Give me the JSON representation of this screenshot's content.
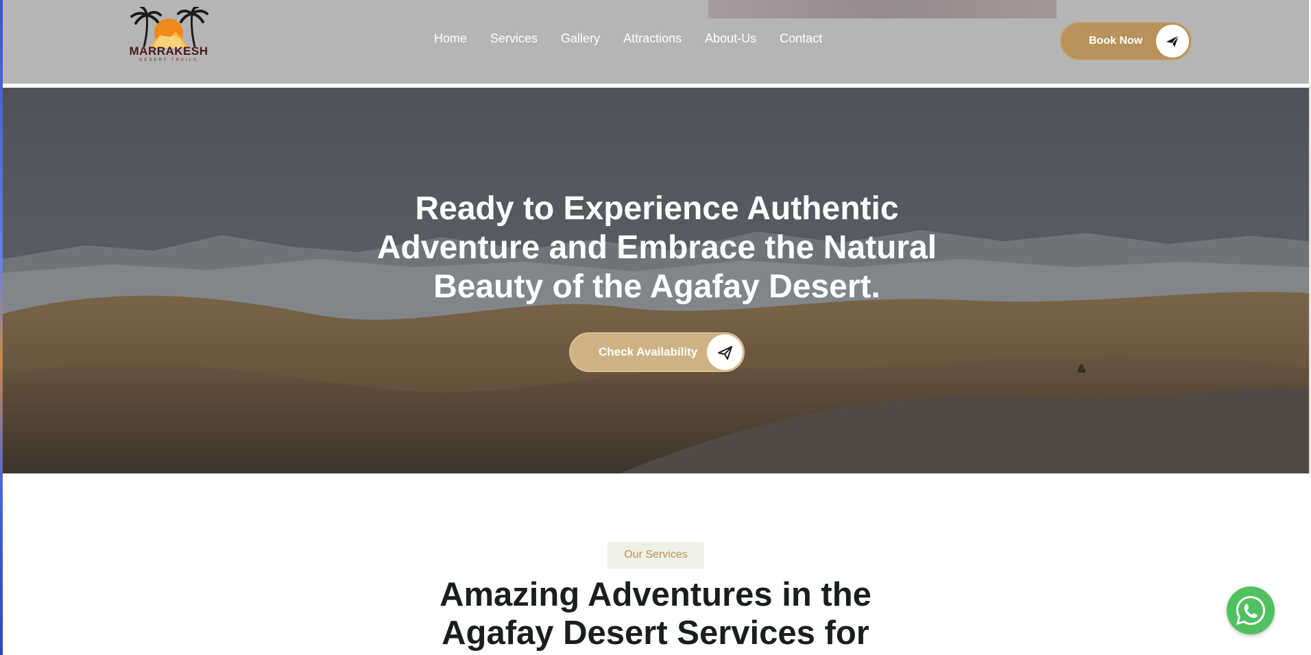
{
  "brand": {
    "name": "MARRAKESH",
    "tagline": "DESERT TRAILS"
  },
  "nav": {
    "items": [
      {
        "label": "Home"
      },
      {
        "label": "Services"
      },
      {
        "label": "Gallery"
      },
      {
        "label": "Attractions"
      },
      {
        "label": "About-Us"
      },
      {
        "label": "Contact"
      }
    ]
  },
  "header": {
    "book_label": "Book Now",
    "book_icon": "paper-plane-icon"
  },
  "hero": {
    "title": "Ready to Experience Authentic Adventure and Embrace the Natural Beauty of the Agafay Desert.",
    "cta_label": "Check Availability",
    "cta_icon": "paper-plane-icon"
  },
  "services": {
    "badge": "Our Services",
    "title": "Amazing Adventures in the Agafay Desert Services for"
  },
  "floating": {
    "whatsapp_icon": "whatsapp-icon"
  },
  "colors": {
    "accent": "#b8915b",
    "accent_light": "#cdb285",
    "header_bg": "#b5b5b5",
    "title_dark": "#1b1f1c",
    "badge_bg": "#eef1e6",
    "whatsapp": "#51c060"
  }
}
